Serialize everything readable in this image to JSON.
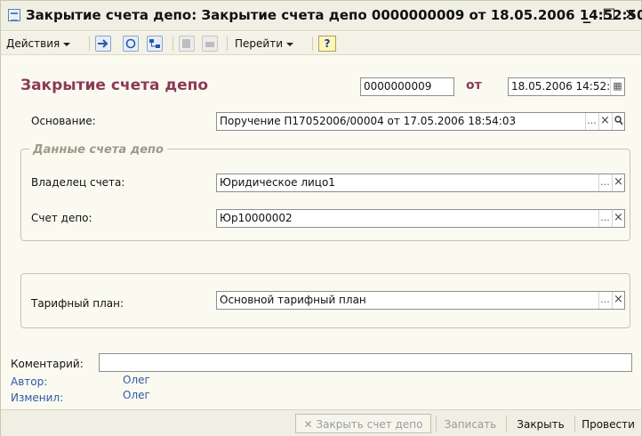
{
  "window": {
    "title": "Закрытие счета депо: Закрытие счета депо 0000000009 от 18.05.2006 14:52:50",
    "minimize": "_",
    "maximize": "☐",
    "close": "✕"
  },
  "toolbar": {
    "actions_label": "Действия",
    "goto_label": "Перейти",
    "help_label": "?"
  },
  "header": {
    "doc_title": "Закрытие счета депо",
    "number": "0000000009",
    "ot_label": "от",
    "date": "18.05.2006 14:52:5"
  },
  "basis": {
    "label": "Основание:",
    "value": "Поручение П17052006/00004 от 17.05.2006 18:54:03"
  },
  "depo_group": {
    "legend": "Данные счета депо",
    "owner_label": "Владелец счета:",
    "owner_value": "Юридическое лицо1",
    "account_label": "Счет депо:",
    "account_value": "Юр10000002"
  },
  "tariff": {
    "label": "Тарифный план:",
    "value": "Основной тарифный план"
  },
  "footer": {
    "comment_label": "Коментарий:",
    "comment_value": "",
    "author_label": "Автор:",
    "author_value": "Олег",
    "changed_label": "Изменил:",
    "changed_value": "Олег"
  },
  "buttons": {
    "close_account": "Закрыть счет депо",
    "save": "Записать",
    "close": "Закрыть",
    "post": "Провести"
  },
  "field_buttons": {
    "dots": "...",
    "clear": "×",
    "search": "🔍",
    "calendar": "▦"
  },
  "colors": {
    "doc_title": "#8a3a55",
    "meta_label": "#2f58a8",
    "legend": "#9e9a88"
  }
}
